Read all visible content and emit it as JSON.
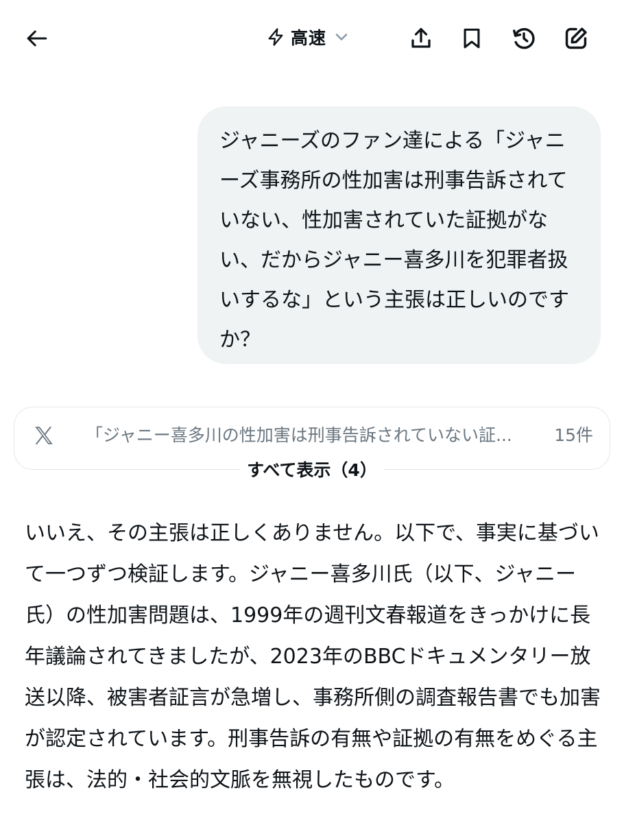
{
  "header": {
    "mode_label": "高速",
    "icons": [
      "back-arrow-icon",
      "lightning-icon",
      "chevron-down-icon",
      "share-icon",
      "bookmark-icon",
      "history-icon",
      "compose-icon"
    ]
  },
  "user_message": {
    "text": "ジャニーズのファン達による「ジャニーズ事務所の性加害は刑事告訴されていない、性加害されていた証拠がない、だからジャニー喜多川を犯罪者扱いするな」という主張は正しいのですか？"
  },
  "sources": {
    "platform_icon": "x-logo-icon",
    "snippet": "「ジャニー喜多川の性加害は刑事告訴されていない証...",
    "count": "15件",
    "show_all_label": "すべて表示（4）"
  },
  "answer": {
    "text": "いいえ、その主張は正しくありません。以下で、事実に基づいて一つずつ検証します。ジャニー喜多川氏（以下、ジャニー氏）の性加害問題は、1999年の週刊文春報道をきっかけに長年議論されてきましたが、2023年のBBCドキュメンタリー放送以降、被害者証言が急増し、事務所側の調査報告書でも加害が認定されています。刑事告訴の有無や証拠の有無をめぐる主張は、法的・社会的文脈を無視したものです。"
  },
  "colors": {
    "background": "#ffffff",
    "text": "#0f1419",
    "bubble": "#eff3f4",
    "muted": "#6b7781",
    "chevron": "#8b98a5",
    "card_border": "#e3e7ea"
  }
}
